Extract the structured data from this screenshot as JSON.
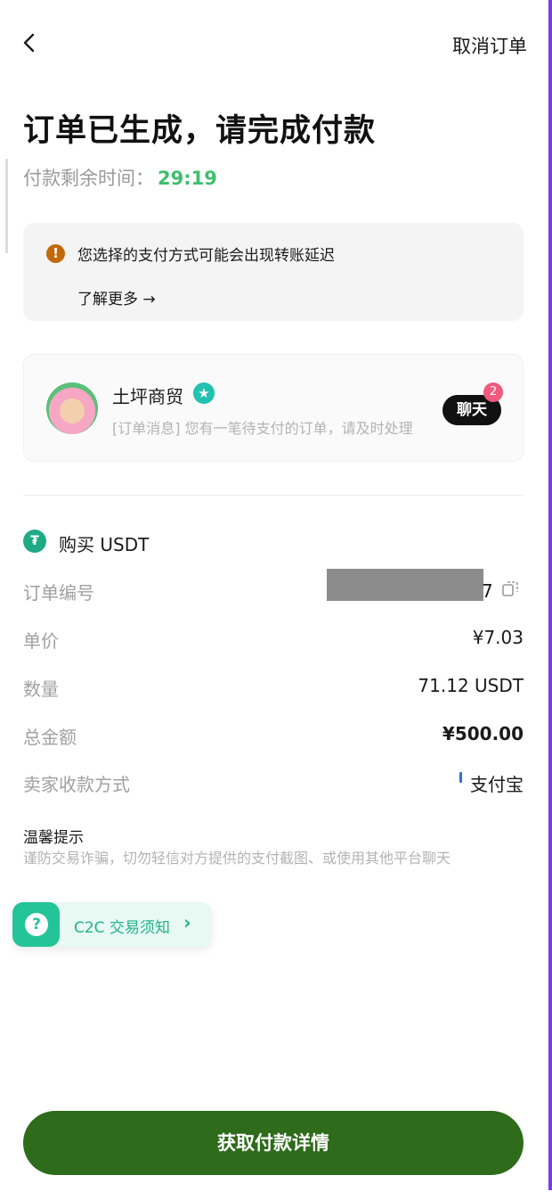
{
  "nav": {
    "cancel_label": "取消订单"
  },
  "header": {
    "title": "订单已生成，请完成付款",
    "timer_label": "付款剩余时间：",
    "timer_value": "29:19"
  },
  "notice": {
    "text": "您选择的支付方式可能会出现转账延迟",
    "learn_more": "了解更多 →"
  },
  "merchant": {
    "name": "土坪商贸",
    "last_message": "[订单消息] 您有一笔待支付的订单，请及时处理",
    "chat_label": "聊天",
    "unread_count": "2"
  },
  "order": {
    "buy_label": "购买 USDT",
    "rows": [
      {
        "label": "订单编号",
        "value": "7"
      },
      {
        "label": "单价",
        "value": "¥7.03"
      },
      {
        "label": "数量",
        "value": "71.12 USDT"
      },
      {
        "label": "总金额",
        "value": "¥500.00"
      },
      {
        "label": "卖家收款方式",
        "value": "支付宝"
      }
    ]
  },
  "tips": {
    "title": "温馨提示",
    "text": "谨防交易诈骗，切勿轻信对方提供的支付截图、或使用其他平台聊天"
  },
  "c2c": {
    "label": "C2C 交易须知",
    "arrow": "›"
  },
  "primary_button": {
    "label": "获取付款详情"
  },
  "colors": {
    "timer": "#3fbf6f",
    "primary": "#2e6b1b",
    "c2c_accent": "#23c498",
    "warning": "#c26a0a",
    "badge": "#f05a7e"
  }
}
